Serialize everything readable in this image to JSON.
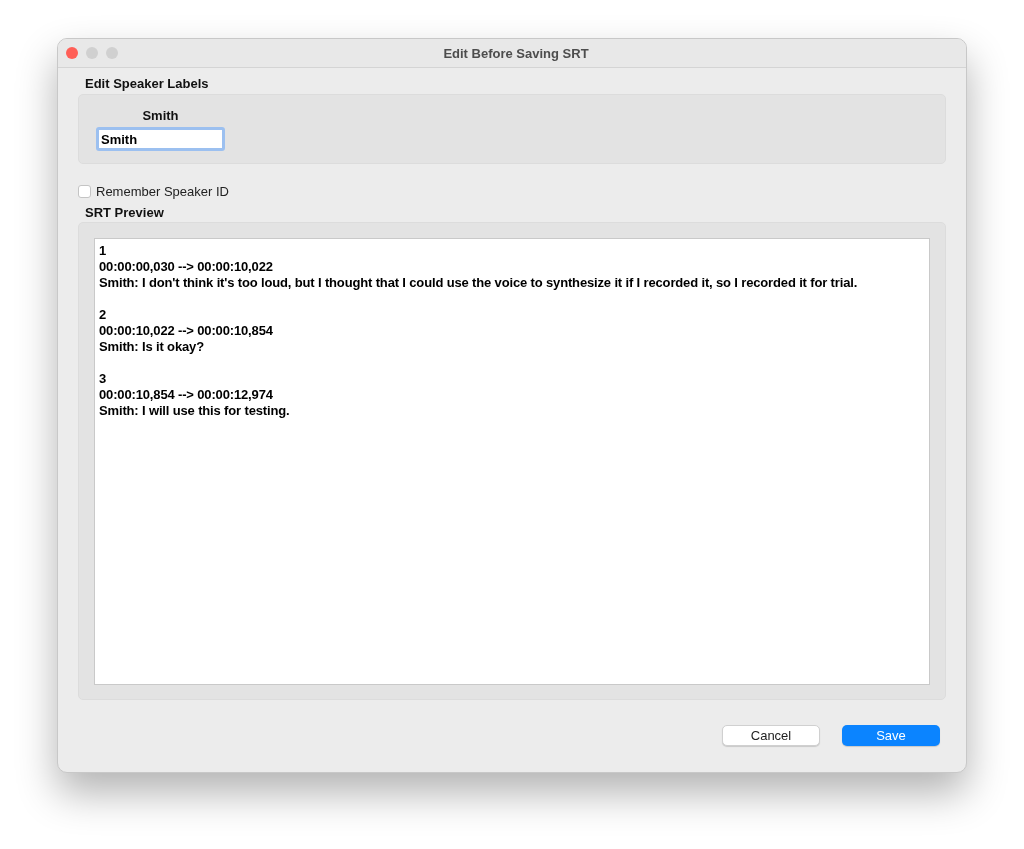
{
  "window": {
    "title": "Edit Before Saving SRT"
  },
  "speaker_labels": {
    "heading": "Edit Speaker Labels",
    "speakers": [
      {
        "label": "Smith",
        "value": "Smith"
      }
    ]
  },
  "remember_speaker_id": {
    "label": "Remember Speaker ID",
    "checked": false
  },
  "srt_preview": {
    "heading": "SRT Preview",
    "entries": [
      {
        "index": "1",
        "timing": "00:00:00,030 --> 00:00:10,022",
        "text": "Smith: I don't think it's too loud, but I thought that I could use the voice to synthesize it if I recorded it, so I recorded it for trial."
      },
      {
        "index": "2",
        "timing": "00:00:10,022 --> 00:00:10,854",
        "text": "Smith: Is it okay?"
      },
      {
        "index": "3",
        "timing": "00:00:10,854 --> 00:00:12,974",
        "text": "Smith: I will use this for testing."
      }
    ]
  },
  "buttons": [
    {
      "label": "Cancel",
      "kind": "secondary"
    },
    {
      "label": "Save",
      "kind": "primary"
    }
  ]
}
